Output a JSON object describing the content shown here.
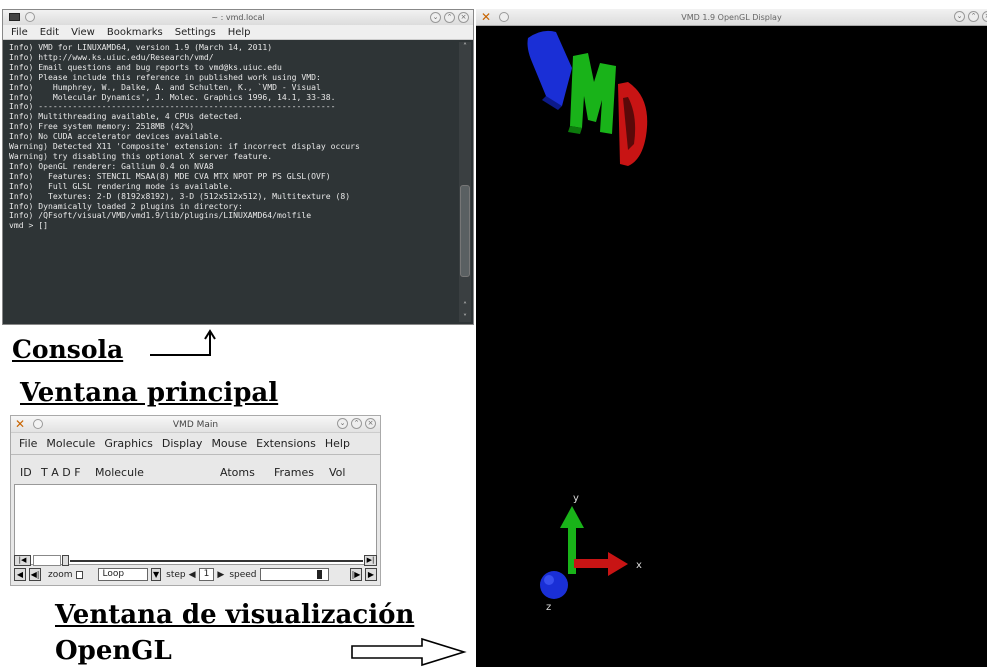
{
  "terminal": {
    "title": "~ : vmd.local",
    "menu": [
      "File",
      "Edit",
      "View",
      "Bookmarks",
      "Settings",
      "Help"
    ],
    "lines": [
      "Info) VMD for LINUXAMD64, version 1.9 (March 14, 2011)",
      "Info) http://www.ks.uiuc.edu/Research/vmd/",
      "Info) Email questions and bug reports to vmd@ks.uiuc.edu",
      "Info) Please include this reference in published work using VMD:",
      "Info)    Humphrey, W., Dalke, A. and Schulten, K., `VMD - Visual",
      "Info)    Molecular Dynamics', J. Molec. Graphics 1996, 14.1, 33-38.",
      "Info) -------------------------------------------------------------",
      "Info) Multithreading available, 4 CPUs detected.",
      "Info) Free system memory: 2518MB (42%)",
      "Info) No CUDA accelerator devices available.",
      "Warning) Detected X11 'Composite' extension: if incorrect display occurs",
      "Warning) try disabling this optional X server feature.",
      "Info) OpenGL renderer: Gallium 0.4 on NVA8",
      "Info)   Features: STENCIL MSAA(8) MDE CVA MTX NPOT PP PS GLSL(OVF)",
      "Info)   Full GLSL rendering mode is available.",
      "Info)   Textures: 2-D (8192x8192), 3-D (512x512x512), Multitexture (8)",
      "Info) Dynamically loaded 2 plugins in directory:",
      "Info) /QFsoft/visual/VMD/vmd1.9/lib/plugins/LINUXAMD64/molfile",
      "vmd > []"
    ]
  },
  "labels": {
    "console": "Consola",
    "main_window": "Ventana principal",
    "display_window_1": "Ventana de visualización",
    "display_window_2": "OpenGL"
  },
  "vmd_main": {
    "title": "VMD Main",
    "menu": [
      "File",
      "Molecule",
      "Graphics",
      "Display",
      "Mouse",
      "Extensions",
      "Help"
    ],
    "columns": {
      "id": "ID",
      "tadf": "T A D F",
      "molecule": "Molecule",
      "atoms": "Atoms",
      "frames": "Frames",
      "vol": "Vol"
    },
    "zoom_label": "zoom",
    "loop_value": "Loop",
    "step_label": "step",
    "step_value": "1",
    "speed_label": "speed"
  },
  "opengl": {
    "title": "VMD 1.9 OpenGL Display",
    "axis_x": "x",
    "axis_y": "y",
    "axis_z": "z",
    "logo_colors": {
      "v": "#1a2fd6",
      "m": "#19b319",
      "d": "#c81414"
    }
  }
}
